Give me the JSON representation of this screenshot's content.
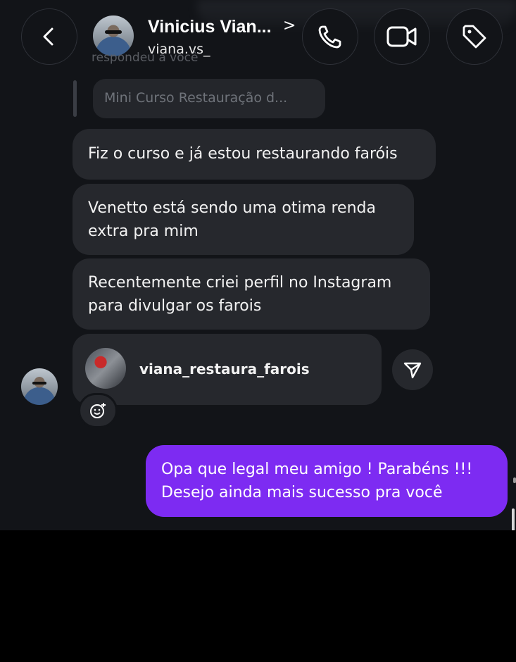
{
  "header": {
    "contact_name": "Vinicius Vian...",
    "username": "viana.vs_",
    "chevron": ">",
    "back_icon": "chevron-left-icon",
    "call_icon": "phone-icon",
    "video_icon": "video-camera-icon",
    "tag_icon": "tag-icon"
  },
  "thread": {
    "ghost_text": "respondeu a você",
    "reply_preview": "Mini Curso Restauração d...",
    "messages": [
      {
        "text_lines": [
          "Fiz o curso e já estou restaurando faróis"
        ]
      },
      {
        "text_lines": [
          "Venetto está sendo uma otima renda",
          "extra pra mim"
        ]
      },
      {
        "text_lines": [
          "Recentemente criei perfil no Instagram",
          "para divulgar os farois"
        ]
      }
    ],
    "shared_profile": {
      "name": "viana_restaura_farois"
    },
    "sent_message": {
      "text_lines": [
        "Opa que legal meu amigo ! Parabéns !!!",
        "Desejo ainda mais sucesso pra você"
      ]
    }
  },
  "colors": {
    "background": "#121418",
    "bubble_received": "#26282d",
    "bubble_sent": "#7d2bf2"
  }
}
